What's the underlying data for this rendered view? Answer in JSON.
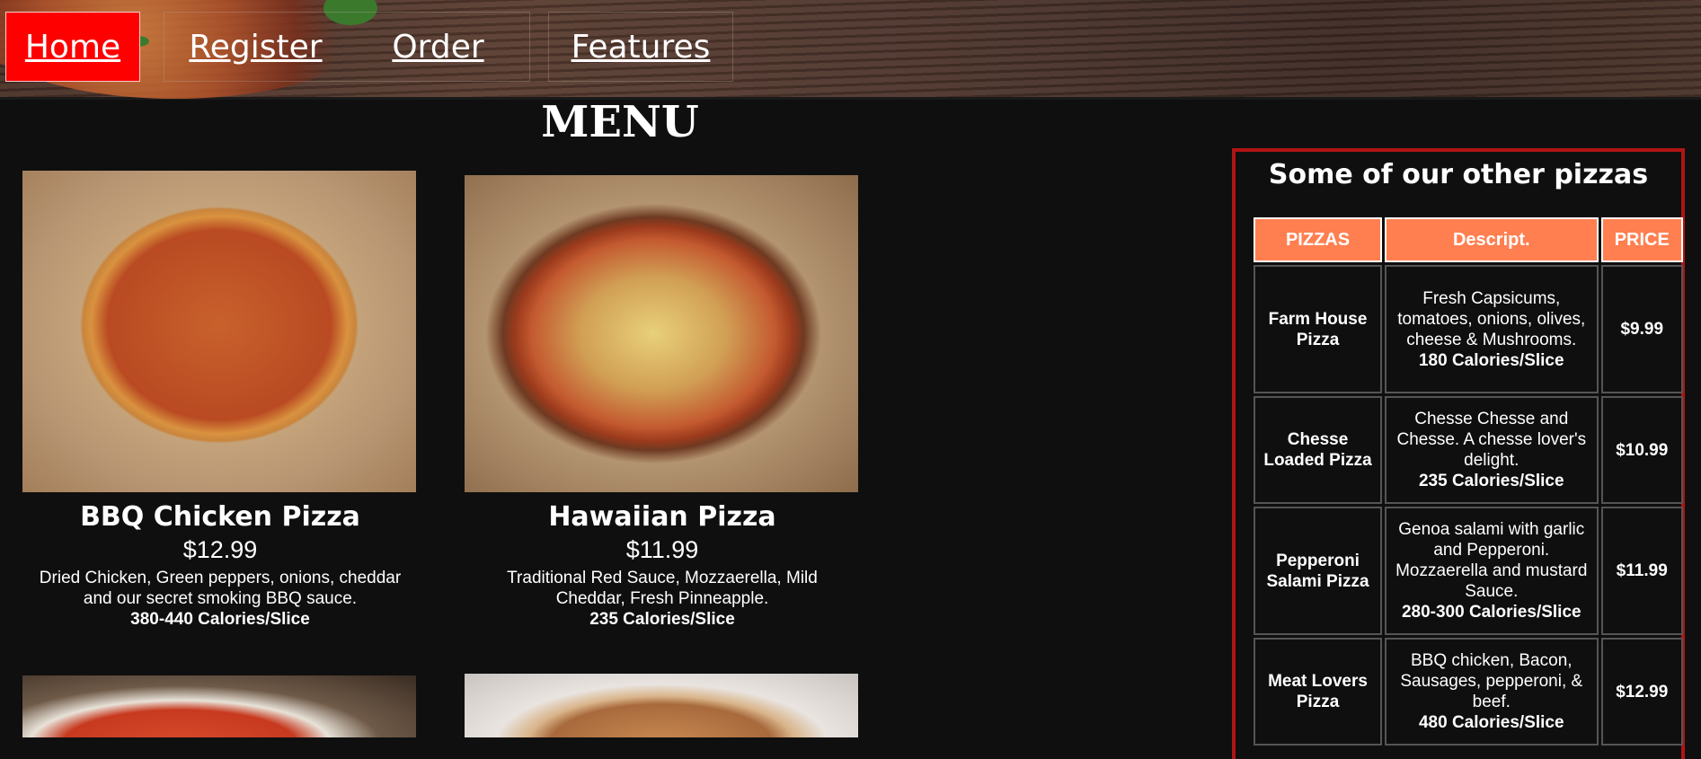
{
  "nav": [
    {
      "label": "Home",
      "active": true
    },
    {
      "label": "Register",
      "active": false
    },
    {
      "label": "Order",
      "active": false
    },
    {
      "label": "Features",
      "active": false
    }
  ],
  "menu_title": "MENU",
  "cards": [
    {
      "name": "BBQ Chicken Pizza",
      "price": "$12.99",
      "description": "Dried Chicken, Green peppers, onions, cheddar and our secret smoking BBQ sauce.",
      "calories": "380-440 Calories/Slice"
    },
    {
      "name": "Hawaiian Pizza",
      "price": "$11.99",
      "description": "Traditional Red Sauce, Mozzaerella, Mild Cheddar, Fresh Pinneapple.",
      "calories": "235 Calories/Slice"
    }
  ],
  "side_panel": {
    "title": "Some of our other pizzas",
    "headers": [
      "PIZZAS",
      "Descript.",
      "PRICE"
    ],
    "rows": [
      {
        "name": "Farm House Pizza",
        "description": "Fresh Capsicums, tomatoes, onions, olives, cheese & Mushrooms.",
        "calories": "180 Calories/Slice",
        "price": "$9.99"
      },
      {
        "name": "Chesse Loaded Pizza",
        "description": "Chesse Chesse and Chesse. A chesse lover's delight.",
        "calories": "235 Calories/Slice",
        "price": "$10.99"
      },
      {
        "name": "Pepperoni Salami Pizza",
        "description": "Genoa salami with garlic and Pepperoni. Mozzaerella and mustard Sauce.",
        "calories": "280-300 Calories/Slice",
        "price": "$11.99"
      },
      {
        "name": "Meat Lovers Pizza",
        "description": "BBQ chicken, Bacon, Sausages, pepperoni, & beef.",
        "calories": "480 Calories/Slice",
        "price": "$12.99"
      }
    ]
  },
  "colors": {
    "nav_active": "#ff0000",
    "table_header": "#ff7f50",
    "panel_border": "#b01414",
    "background": "#0f0f0f"
  }
}
